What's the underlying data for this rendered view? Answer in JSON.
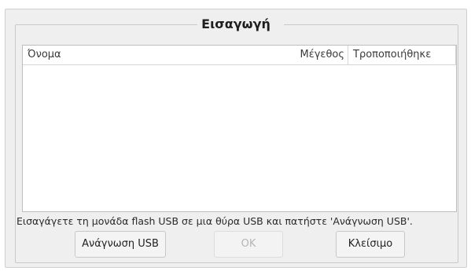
{
  "dialog": {
    "title": "Εισαγωγή"
  },
  "file_list": {
    "columns": [
      "Όνομα",
      "Μέγεθος",
      "Τροποποιήθηκε"
    ],
    "rows": []
  },
  "instruction_text": "Εισαγάγετε τη μονάδα flash USB σε μια θύρα USB και πατήστε 'Ανάγνωση USB'.",
  "buttons": {
    "scan_label": "Ανάγνωση USB",
    "ok_label": "OK",
    "ok_enabled": false,
    "close_label": "Κλείσιμο"
  }
}
